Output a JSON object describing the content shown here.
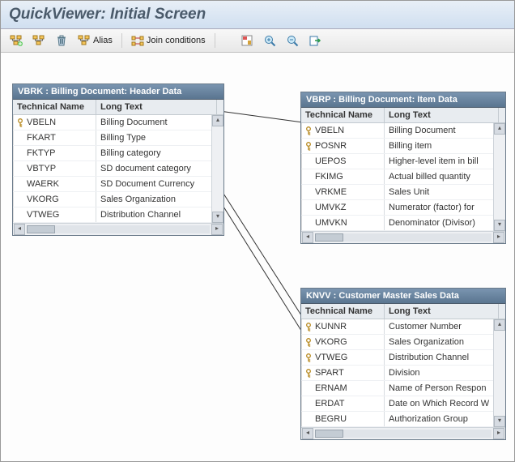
{
  "title": "QuickViewer: Initial Screen",
  "toolbar": {
    "alias_label": "Alias",
    "join_label": "Join conditions"
  },
  "headers": {
    "tech": "Technical Name",
    "long": "Long Text"
  },
  "tables": {
    "vbrk": {
      "title": "VBRK : Billing Document: Header Data",
      "rows": [
        {
          "key": true,
          "tech": "VBELN",
          "long": "Billing Document"
        },
        {
          "key": false,
          "tech": "FKART",
          "long": "Billing Type"
        },
        {
          "key": false,
          "tech": "FKTYP",
          "long": "Billing category"
        },
        {
          "key": false,
          "tech": "VBTYP",
          "long": "SD document category"
        },
        {
          "key": false,
          "tech": "WAERK",
          "long": "SD Document Currency"
        },
        {
          "key": false,
          "tech": "VKORG",
          "long": "Sales Organization"
        },
        {
          "key": false,
          "tech": "VTWEG",
          "long": "Distribution Channel"
        }
      ]
    },
    "vbrp": {
      "title": "VBRP : Billing Document: Item Data",
      "rows": [
        {
          "key": true,
          "tech": "VBELN",
          "long": "Billing Document"
        },
        {
          "key": true,
          "tech": "POSNR",
          "long": "Billing item"
        },
        {
          "key": false,
          "tech": "UEPOS",
          "long": "Higher-level item in bill"
        },
        {
          "key": false,
          "tech": "FKIMG",
          "long": "Actual billed quantity"
        },
        {
          "key": false,
          "tech": "VRKME",
          "long": "Sales Unit"
        },
        {
          "key": false,
          "tech": "UMVKZ",
          "long": "Numerator (factor) for"
        },
        {
          "key": false,
          "tech": "UMVKN",
          "long": "Denominator (Divisor)"
        }
      ]
    },
    "knvv": {
      "title": "KNVV : Customer Master Sales Data",
      "rows": [
        {
          "key": true,
          "tech": "KUNNR",
          "long": "Customer Number"
        },
        {
          "key": true,
          "tech": "VKORG",
          "long": "Sales Organization"
        },
        {
          "key": true,
          "tech": "VTWEG",
          "long": "Distribution Channel"
        },
        {
          "key": true,
          "tech": "SPART",
          "long": "Division"
        },
        {
          "key": false,
          "tech": "ERNAM",
          "long": "Name of Person Respon"
        },
        {
          "key": false,
          "tech": "ERDAT",
          "long": "Date on Which Record W"
        },
        {
          "key": false,
          "tech": "BEGRU",
          "long": "Authorization Group"
        }
      ]
    }
  }
}
